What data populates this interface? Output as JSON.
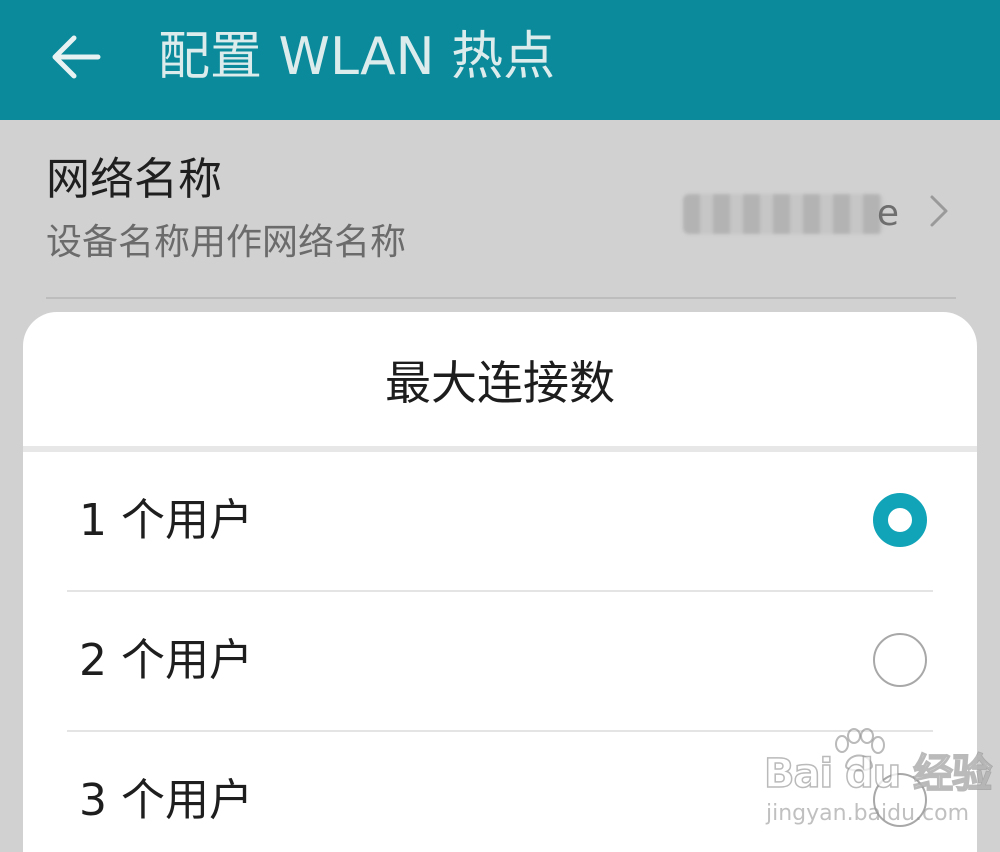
{
  "appbar": {
    "title": "配置 WLAN 热点",
    "color": "#0a8a9a"
  },
  "network_name": {
    "title": "网络名称",
    "subtitle": "设备名称用作网络名称",
    "value_visible": "e",
    "value_redacted": true
  },
  "dialog": {
    "title": "最大连接数",
    "accent": "#11a4b8",
    "options": [
      {
        "label": "1 个用户",
        "selected": true
      },
      {
        "label": "2 个用户",
        "selected": false
      },
      {
        "label": "3 个用户",
        "selected": false
      }
    ]
  },
  "watermark": {
    "brand": "Bai du 经验",
    "url": "jingyan.baidu.com"
  },
  "icons": {
    "back": "arrow-left-icon",
    "chevron": "chevron-right-icon",
    "paw": "paw-print-icon"
  }
}
